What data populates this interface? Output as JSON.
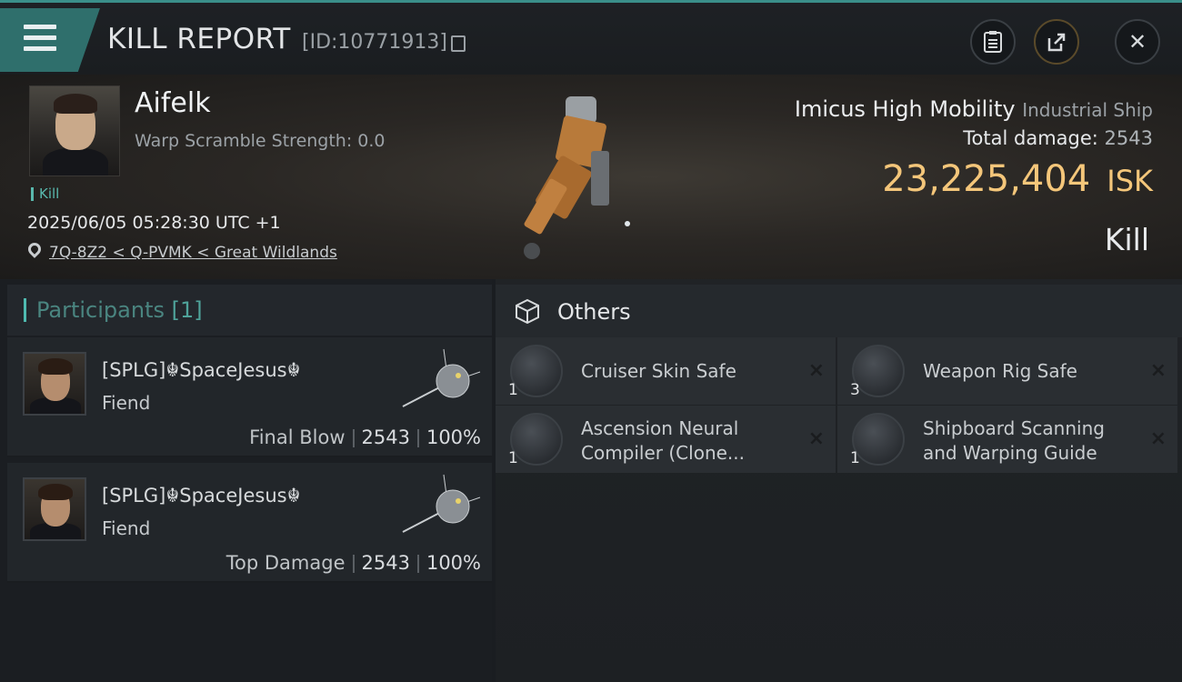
{
  "header": {
    "title": "KILL REPORT",
    "kill_id": "[ID:10771913]"
  },
  "victim": {
    "name": "Aifelk",
    "warp_line": "Warp Scramble Strength: 0.0",
    "tag": "Kill",
    "datetime": "2025/06/05 05:28:30 UTC +1",
    "location": "7Q-8Z2 < Q-PVMK < Great Wildlands"
  },
  "ship": {
    "name": "Imicus High Mobility",
    "class": "Industrial Ship",
    "total_damage_label": "Total damage:",
    "total_damage": "2543",
    "isk_value": "23,225,404",
    "isk_unit": "ISK",
    "result": "Kill"
  },
  "participants": {
    "label": "Participants",
    "count": "[1]",
    "list": [
      {
        "name": "[SPLG]☬SpaceJesus☬",
        "role": "Fiend",
        "stat_label": "Final Blow",
        "damage": "2543",
        "percent": "100%"
      },
      {
        "name": "[SPLG]☬SpaceJesus☬",
        "role": "Fiend",
        "stat_label": "Top Damage",
        "damage": "2543",
        "percent": "100%"
      }
    ]
  },
  "others": {
    "label": "Others",
    "items": [
      {
        "name": "Cruiser Skin Safe",
        "qty": "1",
        "x": "×"
      },
      {
        "name": "Weapon Rig Safe",
        "qty": "3",
        "x": "×"
      },
      {
        "name": "Ascension Neural Compiler (Clone...",
        "qty": "1",
        "x": "×"
      },
      {
        "name": "Shipboard Scanning and Warping Guide",
        "qty": "1",
        "x": "×"
      }
    ]
  },
  "icons": {
    "close": "✕",
    "clipboard": "clipboard-icon",
    "share": "share-icon"
  },
  "colors": {
    "accent": "#3a8f8a",
    "isk": "#f4c67a",
    "teal_text": "#59b8ad"
  }
}
